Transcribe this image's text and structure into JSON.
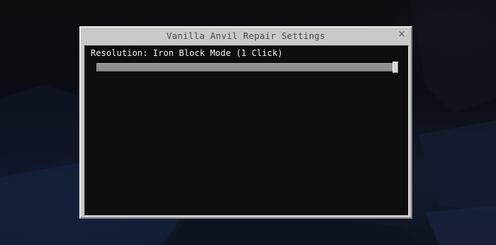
{
  "dialog": {
    "title": "Vanilla Anvil Repair Settings",
    "close_glyph": "×",
    "close_icon": "close-icon"
  },
  "settings": [
    {
      "label": "Resolution: Iron Block Mode (1 Click)",
      "control": "slider",
      "value_fraction": 1.0
    }
  ],
  "colors": {
    "dialog_frame": "#c9c9c9",
    "content_background": "#0e0e0e",
    "label_text": "#f2f2f2",
    "title_text": "#4a4a4a",
    "slider_track": "#8e8e8e",
    "slider_thumb": "#d6d6d6"
  }
}
